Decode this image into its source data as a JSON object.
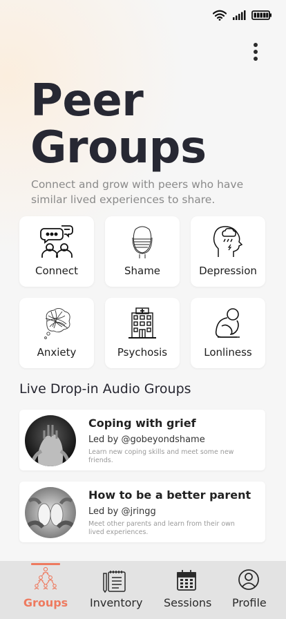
{
  "status_bar": {
    "icons": [
      "wifi-icon",
      "signal-icon",
      "battery-icon"
    ]
  },
  "header": {
    "menu_icon": "more-vertical-icon"
  },
  "title": {
    "line1": "Peer",
    "line2": "Groups"
  },
  "subtitle": "Connect and grow with peers who have similar lived experiences to share.",
  "categories": [
    {
      "label": "Connect",
      "icon": "chat-people-icon"
    },
    {
      "label": "Shame",
      "icon": "face-hidden-icon"
    },
    {
      "label": "Depression",
      "icon": "head-rain-cloud-icon"
    },
    {
      "label": "Anxiety",
      "icon": "tangled-thoughts-icon"
    },
    {
      "label": "Psychosis",
      "icon": "hospital-icon"
    },
    {
      "label": "Lonliness",
      "icon": "sitting-alone-icon"
    }
  ],
  "section_title": "Live Drop-in Audio Groups",
  "groups": [
    {
      "title": "Coping with grief",
      "leader": "Led by @gobeyondshame",
      "desc": "Learn new coping skills and meet some new friends.",
      "image": "hands-over-face-photo"
    },
    {
      "title": "How to be a better parent",
      "leader": "Led by @jringg",
      "desc": "Meet other parents and learn from their own lived experiences.",
      "image": "baby-feet-hands-photo"
    }
  ],
  "tabs": [
    {
      "label": "Groups",
      "icon": "people-network-icon",
      "active": true
    },
    {
      "label": "Inventory",
      "icon": "notepad-pen-icon",
      "active": false
    },
    {
      "label": "Sessions",
      "icon": "calendar-icon",
      "active": false
    },
    {
      "label": "Profile",
      "icon": "user-circle-icon",
      "active": false
    }
  ],
  "colors": {
    "accent": "#ee7a5f",
    "title": "#272833",
    "subtitle": "#8a8a8a",
    "tabbar": "#e3e3e3"
  }
}
